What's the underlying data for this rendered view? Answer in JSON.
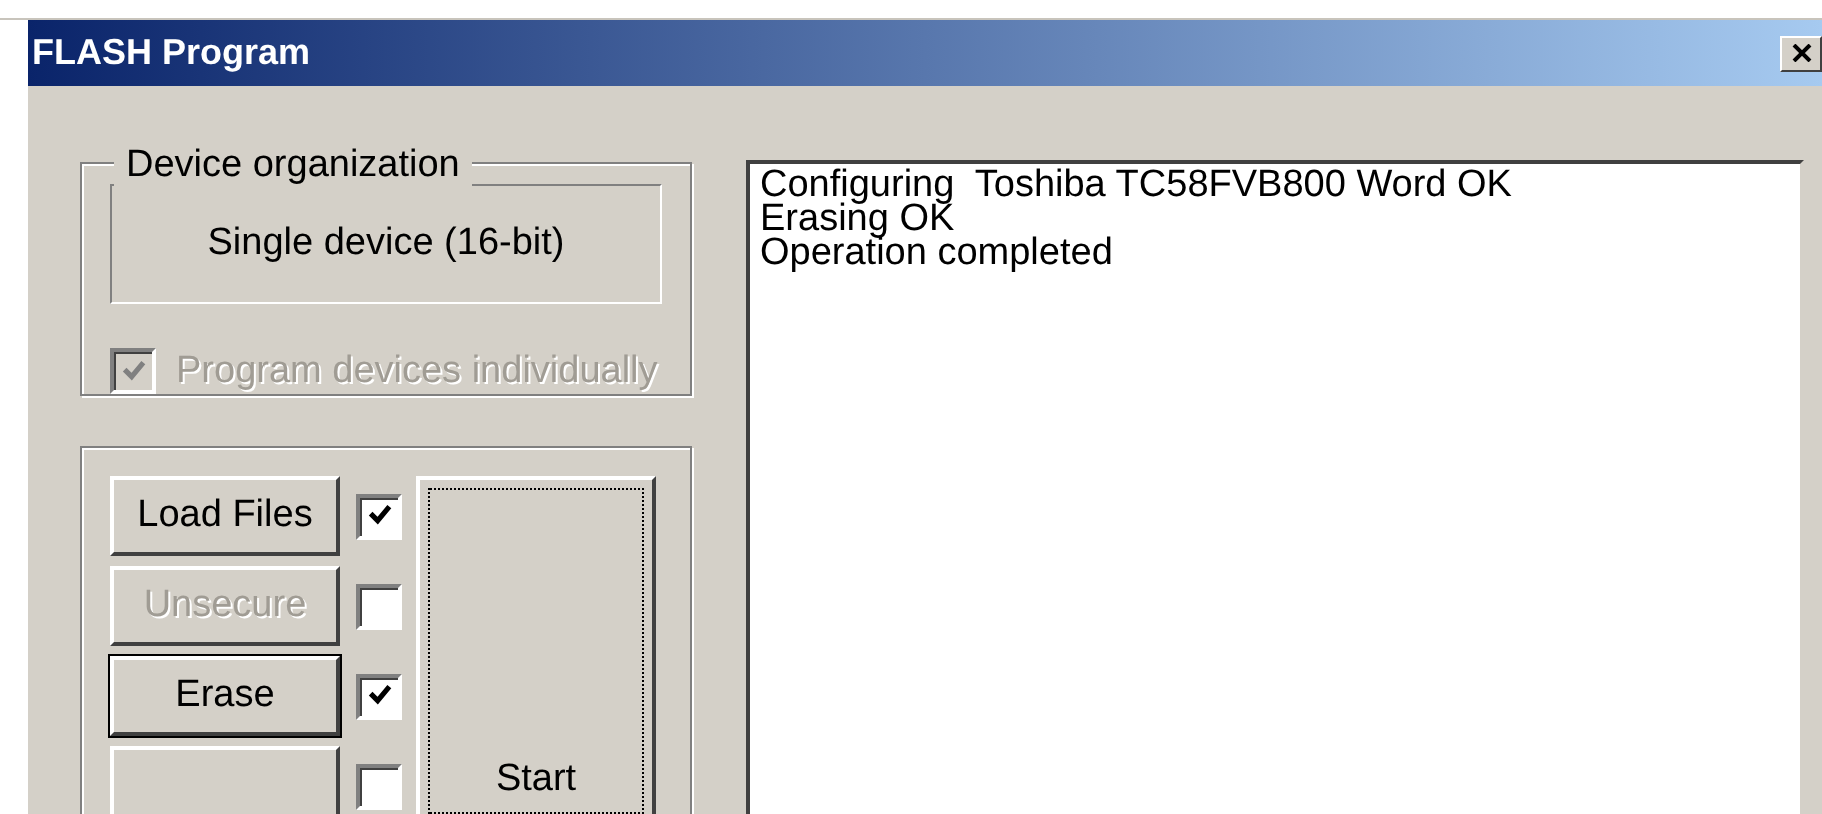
{
  "window": {
    "title": "FLASH Program"
  },
  "device_organization": {
    "title": "Device organization",
    "value": "Single device (16-bit)",
    "option": {
      "label": "Program devices individually",
      "checked": true,
      "disabled": true
    }
  },
  "steps": [
    {
      "label": "Load Files",
      "disabled": false,
      "default": false,
      "checked": true
    },
    {
      "label": "Unsecure",
      "disabled": true,
      "default": false,
      "checked": false
    },
    {
      "label": "Erase",
      "disabled": false,
      "default": true,
      "checked": true
    },
    {
      "checked": false
    }
  ],
  "start_button": {
    "label": "Start",
    "focused": true
  },
  "log": [
    "Configuring  Toshiba TC58FVB800 Word OK",
    "Erasing OK",
    "Operation completed"
  ]
}
